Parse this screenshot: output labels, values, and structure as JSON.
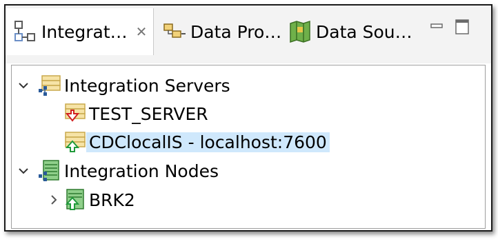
{
  "tabs": [
    {
      "label": "Integrat…",
      "icon": "integration-explorer-icon",
      "active": true,
      "close": "✕"
    },
    {
      "label": "Data Pro…",
      "icon": "data-project-icon"
    },
    {
      "label": "Data Sou…",
      "icon": "data-source-icon"
    }
  ],
  "window_controls": {
    "minimize": "minimize-icon",
    "maximize": "maximize-icon"
  },
  "tree": [
    {
      "label": "Integration Servers",
      "expanded": true,
      "icon": "integration-servers-icon",
      "children": [
        {
          "label": "TEST_SERVER",
          "icon": "server-stopped-icon",
          "status": "stopped"
        },
        {
          "label": "CDClocalIS - localhost:7600",
          "icon": "server-running-icon",
          "status": "running",
          "selected": true
        }
      ]
    },
    {
      "label": "Integration Nodes",
      "expanded": true,
      "icon": "integration-nodes-icon",
      "children": [
        {
          "label": "BRK2",
          "icon": "node-running-icon",
          "status": "running",
          "collapsed": true
        }
      ]
    }
  ],
  "colors": {
    "selection": "#cfe8fc",
    "running": "#1f9a3a",
    "stopped": "#d11f1f",
    "server_fill": "#f6e3a6"
  }
}
